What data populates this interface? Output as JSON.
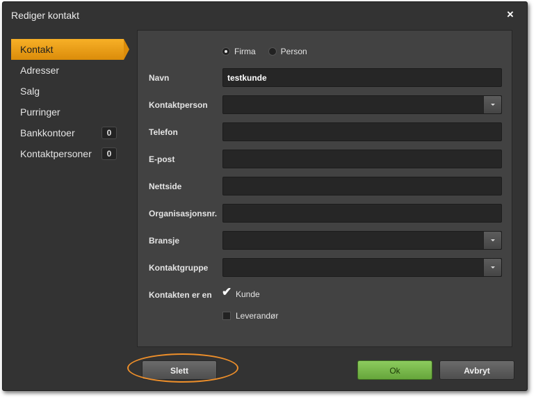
{
  "dialog": {
    "title": "Rediger kontakt",
    "close_icon": "×"
  },
  "sidebar": {
    "items": [
      {
        "label": "Kontakt",
        "active": true
      },
      {
        "label": "Adresser"
      },
      {
        "label": "Salg"
      },
      {
        "label": "Purringer"
      },
      {
        "label": "Bankkontoer",
        "badge": "0"
      },
      {
        "label": "Kontaktpersoner",
        "badge": "0"
      }
    ]
  },
  "form": {
    "type_options": [
      {
        "label": "Firma",
        "selected": true
      },
      {
        "label": "Person",
        "selected": false
      }
    ],
    "fields": {
      "navn": {
        "label": "Navn",
        "value": "testkunde"
      },
      "kontaktperson": {
        "label": "Kontaktperson",
        "value": ""
      },
      "telefon": {
        "label": "Telefon",
        "value": ""
      },
      "epost": {
        "label": "E-post",
        "value": ""
      },
      "nettside": {
        "label": "Nettside",
        "value": ""
      },
      "orgnr": {
        "label": "Organisasjonsnr.",
        "value": ""
      },
      "bransje": {
        "label": "Bransje",
        "value": ""
      },
      "kontaktgruppe": {
        "label": "Kontaktgruppe",
        "value": ""
      }
    },
    "role": {
      "label": "Kontakten er en",
      "options": [
        {
          "label": "Kunde",
          "checked": true
        },
        {
          "label": "Leverandør",
          "checked": false
        }
      ]
    }
  },
  "buttons": {
    "delete": "Slett",
    "ok": "Ok",
    "cancel": "Avbryt"
  },
  "colors": {
    "accent": "#f0a020",
    "ok_green": "#79b84b",
    "highlight": "#ee8f2a"
  }
}
